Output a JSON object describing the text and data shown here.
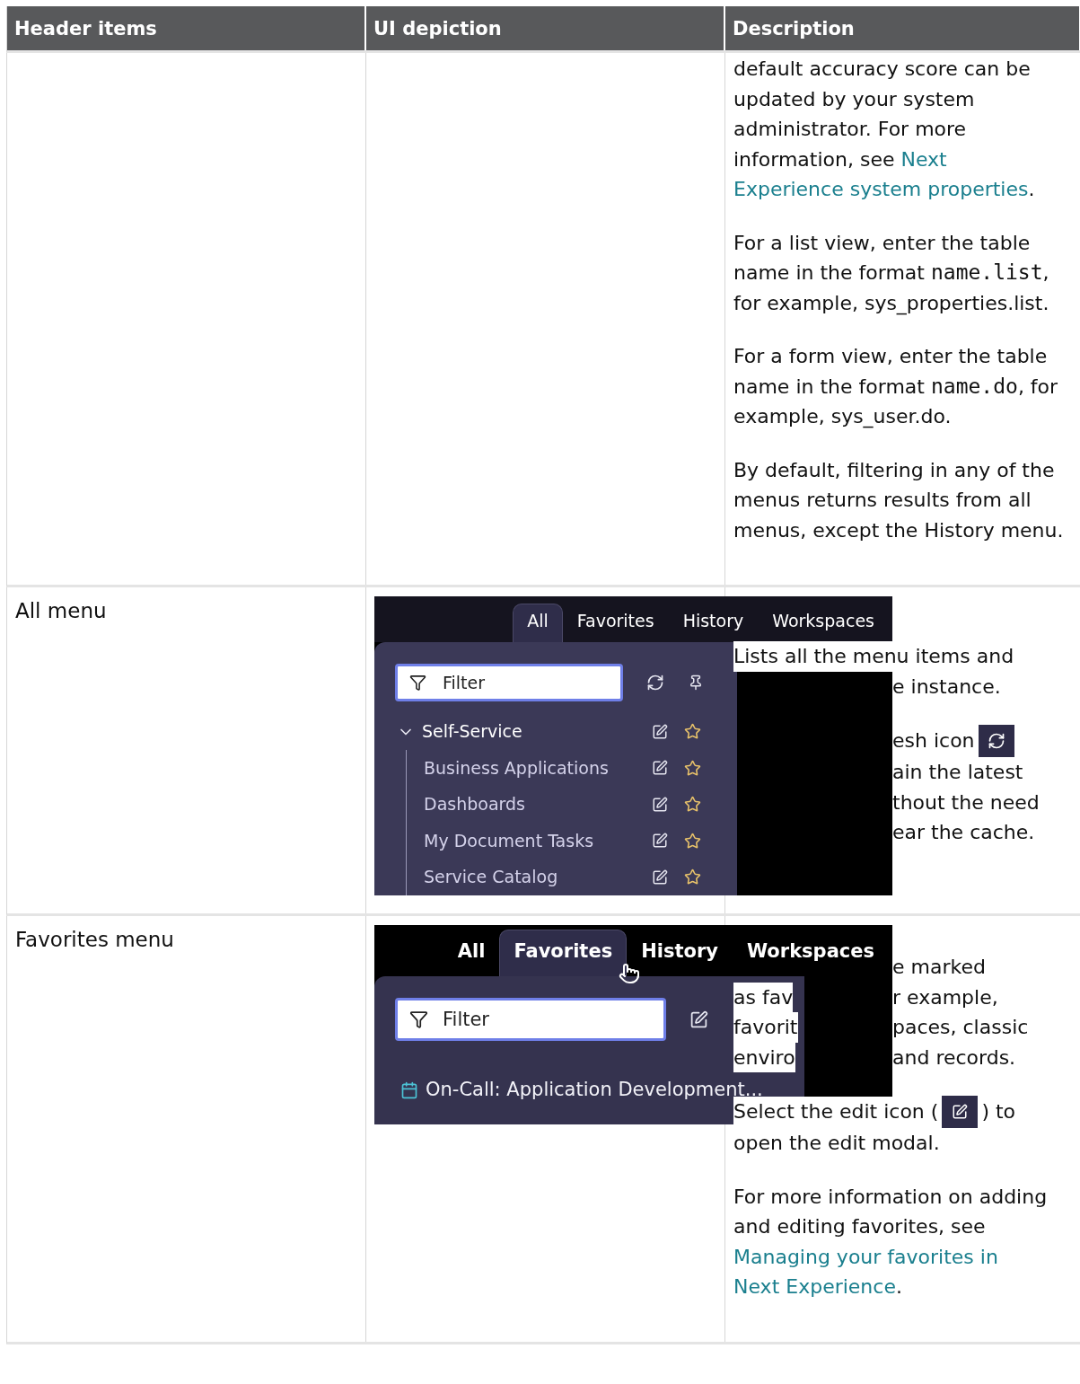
{
  "table": {
    "columns": [
      "Header items",
      "UI depiction",
      "Description"
    ],
    "rows": [
      {
        "kind": "text",
        "description": [
          [
            {
              "kind": "text",
              "text": "default accuracy score can be updated by your system administrator. For more information, see "
            },
            {
              "kind": "link",
              "text": "Next"
            },
            {
              "kind": "link",
              "text": "Experience system properties"
            },
            {
              "kind": "text",
              "text": "."
            }
          ],
          [
            {
              "kind": "text",
              "text": "For a list view, enter the table name in the format "
            },
            {
              "kind": "code",
              "text": "name.list"
            },
            {
              "kind": "text",
              "text": ", for example, sys_properties.list."
            }
          ],
          [
            {
              "kind": "text",
              "text": "For a form view, enter the table name in the format "
            },
            {
              "kind": "code",
              "text": "name.do"
            },
            {
              "kind": "text",
              "text": ", for example, sys_user.do."
            }
          ],
          [
            {
              "kind": "text",
              "text": "By default, filtering in any of the menus returns results from all menus, except the History menu."
            }
          ]
        ]
      },
      {
        "kind": "all_menu",
        "header": "All menu",
        "depiction": {
          "tabs": [
            {
              "label": "All",
              "selected": true
            },
            {
              "label": "Favorites",
              "selected": false
            },
            {
              "label": "History",
              "selected": false
            },
            {
              "label": "Workspaces",
              "selected": false
            }
          ],
          "filter_placeholder": "Filter",
          "tree": [
            {
              "label": "Self-Service",
              "expanded": true,
              "children": [
                {
                  "label": "Business Applications"
                },
                {
                  "label": "Dashboards"
                },
                {
                  "label": "My Document Tasks"
                },
                {
                  "label": "Service Catalog"
                }
              ]
            }
          ]
        },
        "description_lines": [
          [
            {
              "kind": "full",
              "parts": [
                {
                  "kind": "text",
                  "text": "Lists all the menu items and"
                }
              ]
            },
            {
              "kind": "right",
              "parts": [
                {
                  "kind": "text",
                  "text": "e instance."
                }
              ]
            }
          ],
          [
            {
              "kind": "right",
              "parts": [
                {
                  "kind": "text",
                  "text": "esh icon"
                },
                {
                  "kind": "tile"
                }
              ]
            },
            {
              "kind": "right",
              "parts": [
                {
                  "kind": "text",
                  "text": "ain the latest"
                }
              ]
            },
            {
              "kind": "right",
              "parts": [
                {
                  "kind": "text",
                  "text": "thout the need"
                }
              ]
            },
            {
              "kind": "right",
              "parts": [
                {
                  "kind": "text",
                  "text": "ear the cache."
                }
              ]
            }
          ]
        ]
      },
      {
        "kind": "favorites_menu",
        "header": "Favorites menu",
        "depiction": {
          "tabs": [
            {
              "label": "All",
              "selected": false
            },
            {
              "label": "Favorites",
              "selected": true
            },
            {
              "label": "History",
              "selected": false
            },
            {
              "label": "Workspaces",
              "selected": false
            }
          ],
          "filter_placeholder": "Filter",
          "favorites": [
            "On-Call: Application Development..."
          ]
        },
        "description_lines": [
          [
            {
              "kind": "right",
              "parts": [
                {
                  "kind": "text",
                  "text": "e marked"
                }
              ]
            },
            {
              "kind": "split",
              "left": "as fav",
              "parts": [
                {
                  "kind": "text",
                  "text": "r example,"
                }
              ]
            },
            {
              "kind": "split",
              "left": "favorit",
              "parts": [
                {
                  "kind": "text",
                  "text": "paces, classic"
                }
              ]
            },
            {
              "kind": "split",
              "left": "enviro",
              "parts": [
                {
                  "kind": "text",
                  "text": "and records."
                }
              ]
            }
          ],
          [
            {
              "kind": "full",
              "parts": [
                {
                  "kind": "text",
                  "text": "Select the edit icon ("
                },
                {
                  "kind": "tile"
                },
                {
                  "kind": "text",
                  "text": ") to"
                }
              ]
            },
            {
              "kind": "full",
              "parts": [
                {
                  "kind": "text",
                  "text": "open the edit modal."
                }
              ]
            }
          ]
        ],
        "description": [
          [
            {
              "kind": "text",
              "text": "For more information on adding and editing favorites, see "
            },
            {
              "kind": "link",
              "text": "Managing your favorites in"
            },
            {
              "kind": "link",
              "text": "Next Experience"
            },
            {
              "kind": "text",
              "text": "."
            }
          ]
        ]
      }
    ]
  }
}
